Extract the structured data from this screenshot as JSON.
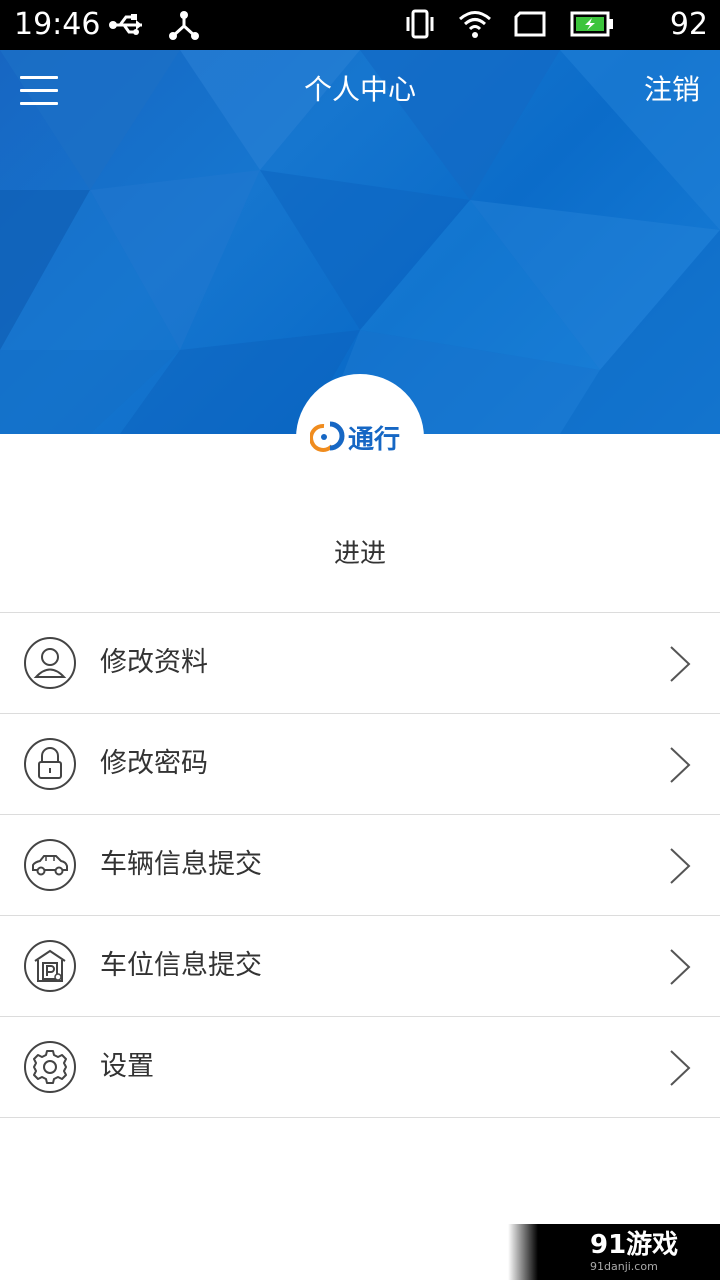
{
  "status_bar": {
    "time": "19:46",
    "battery": "92",
    "icons": [
      "usb-icon",
      "share-icon",
      "vibrate-icon",
      "wifi-icon",
      "screen-icon",
      "battery-charging-icon"
    ]
  },
  "header": {
    "menu_icon": "hamburger-menu-icon",
    "title": "个人中心",
    "logout_label": "注销",
    "background_color": "#1671cc"
  },
  "profile": {
    "logo_text": "通行",
    "username": "进进"
  },
  "menu": {
    "items": [
      {
        "label": "修改资料",
        "icon": "user-icon"
      },
      {
        "label": "修改密码",
        "icon": "lock-icon"
      },
      {
        "label": "车辆信息提交",
        "icon": "car-icon"
      },
      {
        "label": "车位信息提交",
        "icon": "parking-icon"
      },
      {
        "label": "设置",
        "icon": "gear-icon"
      }
    ]
  },
  "watermark": {
    "logo": "91游戏",
    "url": "91danji.com"
  },
  "colors": {
    "accent": "#1671cc",
    "logo_orange": "#f08c1e",
    "text": "#333333",
    "divider": "#dcdcdc"
  }
}
